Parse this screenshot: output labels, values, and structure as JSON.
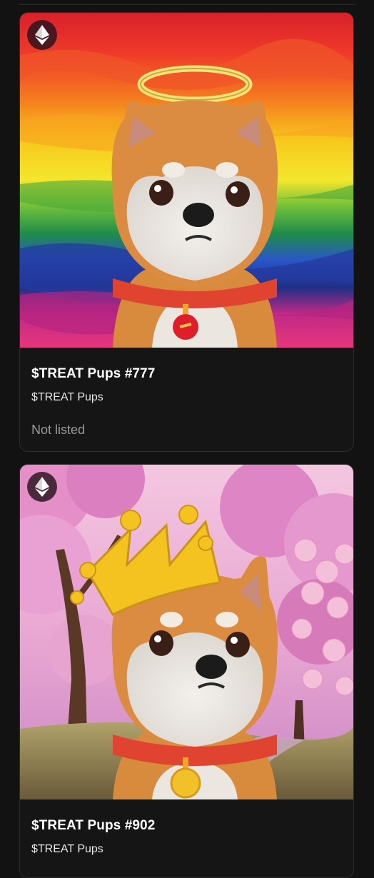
{
  "cards": [
    {
      "title": "$TREAT Pups #777",
      "collection": "$TREAT Pups",
      "status": "Not listed",
      "chain_icon": "ethereum-icon",
      "art": "shiba-halo-rainbow"
    },
    {
      "title": "$TREAT Pups #902",
      "collection": "$TREAT Pups",
      "chain_icon": "ethereum-icon",
      "art": "shiba-crown-cherry-blossom"
    }
  ],
  "colors": {
    "background": "#121212",
    "card_background": "#151515",
    "card_border": "#2c2c2c",
    "muted_text": "#9a9a9a"
  }
}
